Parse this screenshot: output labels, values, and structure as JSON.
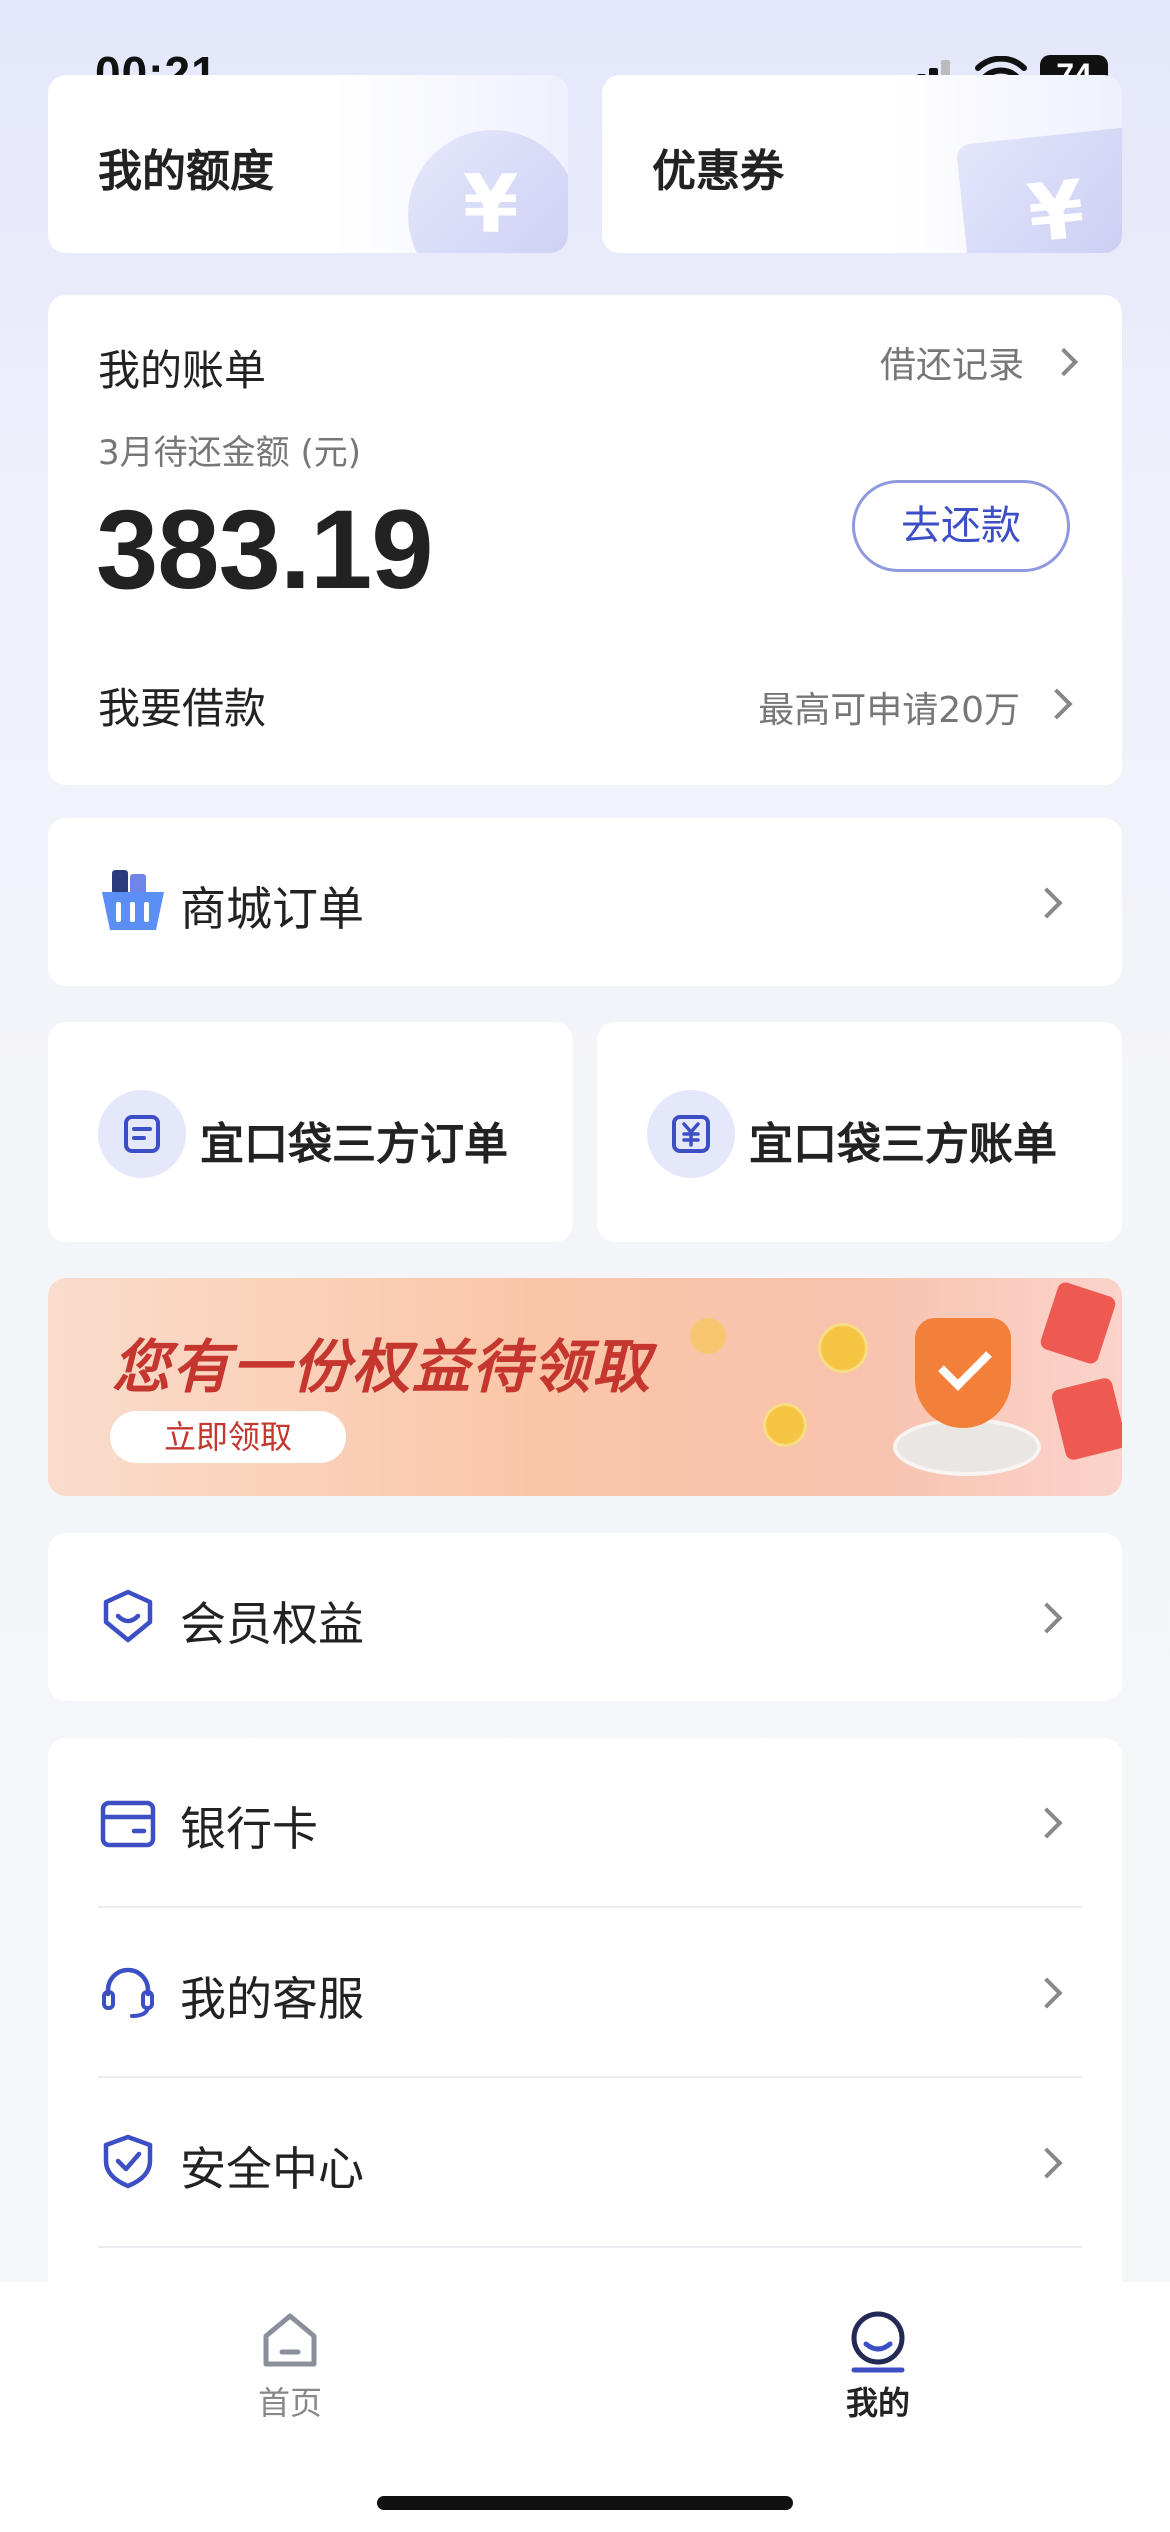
{
  "status_bar": {
    "time": "00:21",
    "battery": "74"
  },
  "top_cards": {
    "quota_label": "我的额度",
    "coupon_label": "优惠券",
    "yen_glyph": "¥"
  },
  "bill": {
    "title": "我的账单",
    "history_link": "借还记录",
    "due_label": "3月待还金额 (元)",
    "amount": "383.19",
    "repay_button": "去还款",
    "borrow_label": "我要借款",
    "borrow_hint": "最高可申请20万"
  },
  "mall_order": {
    "label": "商城订单"
  },
  "third_party": {
    "orders_label": "宜口袋三方订单",
    "bills_label": "宜口袋三方账单"
  },
  "banner": {
    "headline": "您有一份权益待领取",
    "button": "立即领取"
  },
  "member": {
    "label": "会员权益"
  },
  "menu": {
    "items": [
      {
        "label": "银行卡",
        "icon": "bank-card-icon"
      },
      {
        "label": "我的客服",
        "icon": "headset-icon"
      },
      {
        "label": "安全中心",
        "icon": "shield-check-icon"
      }
    ]
  },
  "tabbar": {
    "home": "首页",
    "mine": "我的"
  },
  "colors": {
    "accent": "#3d4fc4",
    "banner_text": "#c4362e"
  }
}
